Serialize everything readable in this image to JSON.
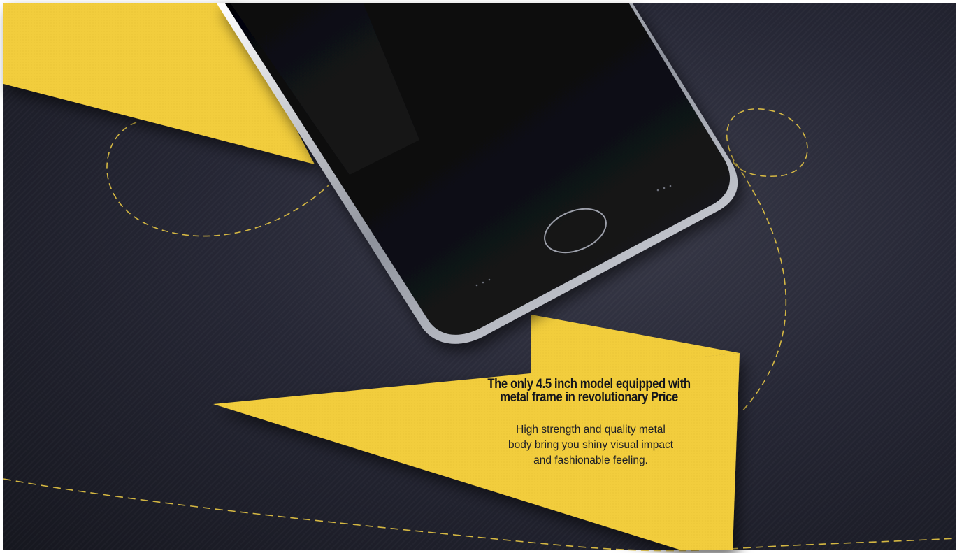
{
  "promo": {
    "headline_line1": "The only 4.5 inch model equipped with",
    "headline_line2": "metal frame in revolutionary Price",
    "body_line1": "High strength and quality metal",
    "body_line2": "body bring you shiny visual impact",
    "body_line3": "and fashionable feeling."
  },
  "colors": {
    "background": "#262735",
    "accent_yellow": "#f2cd3c",
    "dashed_line": "#e8c845",
    "phone_body": "#0c0d10",
    "phone_frame": "#c9ccd4"
  },
  "icons": {
    "home_button": "fingerprint-home-button-icon",
    "speaker_grille": "speaker-dots-icon"
  }
}
